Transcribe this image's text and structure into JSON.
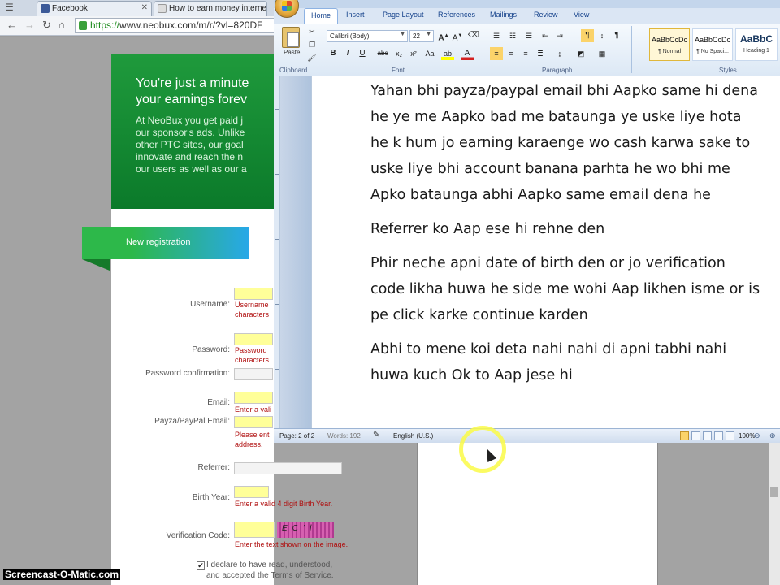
{
  "browser": {
    "tabs": [
      {
        "title": "Facebook",
        "favicon_color": "#3b5998"
      },
      {
        "title": "How to earn money internet"
      },
      {
        "title": ""
      }
    ],
    "url_scheme": "https://",
    "url_rest": "www.neobux.com/m/r/?vl=820DF"
  },
  "neobux": {
    "headline_1": "You're just a minute",
    "headline_2": "your earnings forev",
    "body_lines": [
      "At NeoBux you get paid j",
      "our sponsor's ads. Unlike",
      "other PTC sites, our goal",
      "innovate and reach the n",
      "our users as well as our a"
    ],
    "ribbon_label": "New registration",
    "fields": {
      "username": {
        "label": "Username:",
        "error": [
          "Username",
          "characters"
        ]
      },
      "password": {
        "label": "Password:",
        "error": [
          "Password",
          "characters"
        ]
      },
      "password_confirm": {
        "label": "Password confirmation:"
      },
      "email": {
        "label": "Email:",
        "error": [
          "Enter a vali"
        ]
      },
      "payza": {
        "label": "Payza/PayPal Email:",
        "error": [
          "Please ent",
          "address."
        ]
      },
      "referrer": {
        "label": "Referrer:"
      },
      "birth_year": {
        "label": "Birth Year:",
        "error": [
          "Enter a valid 4 digit Birth Year."
        ]
      },
      "verification": {
        "label": "Verification Code:",
        "error": [
          "Enter the text shown on the image."
        ],
        "captcha": "EC’l"
      }
    },
    "declare": [
      "I declare to have read, understood,",
      "and accepted the Terms of Service."
    ],
    "declare_checked": "✔"
  },
  "word": {
    "tabs": [
      "Home",
      "Insert",
      "Page Layout",
      "References",
      "Mailings",
      "Review",
      "View"
    ],
    "active_tab": "Home",
    "groups": {
      "clipboard": "Clipboard",
      "font": "Font",
      "paragraph": "Paragraph",
      "styles": "Styles"
    },
    "paste_label": "Paste",
    "font_name": "Calibri (Body)",
    "font_size": "22",
    "styles": [
      {
        "sample": "AaBbCcDc",
        "name": "¶ Normal"
      },
      {
        "sample": "AaBbCcDc",
        "name": "¶ No Spaci..."
      },
      {
        "sample": "AaBbC",
        "name": "Heading 1"
      }
    ],
    "document": {
      "p1": "Yahan bhi payza/paypal email bhi Aapko same hi dena he ye me Aapko bad me bataunga ye uske liye hota he k hum jo earning karaenge wo cash karwa sake to uske liye bhi account banana parhta he wo bhi me Apko bataunga abhi Aapko same email dena he",
      "p2": "Referrer ko Aap ese hi rehne den",
      "p3": "Phir neche apni date of birth den or jo verification code likha huwa he side me wohi Aap likhen isme or is pe click karke continue karden",
      "p4": "Abhi to mene koi deta nahi nahi di apni tabhi nahi huwa kuch Ok to Aap jese hi"
    },
    "status": {
      "page": "Page: 2 of 2",
      "words": "Words: 192",
      "language": "English (U.S.)",
      "zoom": "100%"
    }
  },
  "watermark": "Screencast-O-Matic.com"
}
